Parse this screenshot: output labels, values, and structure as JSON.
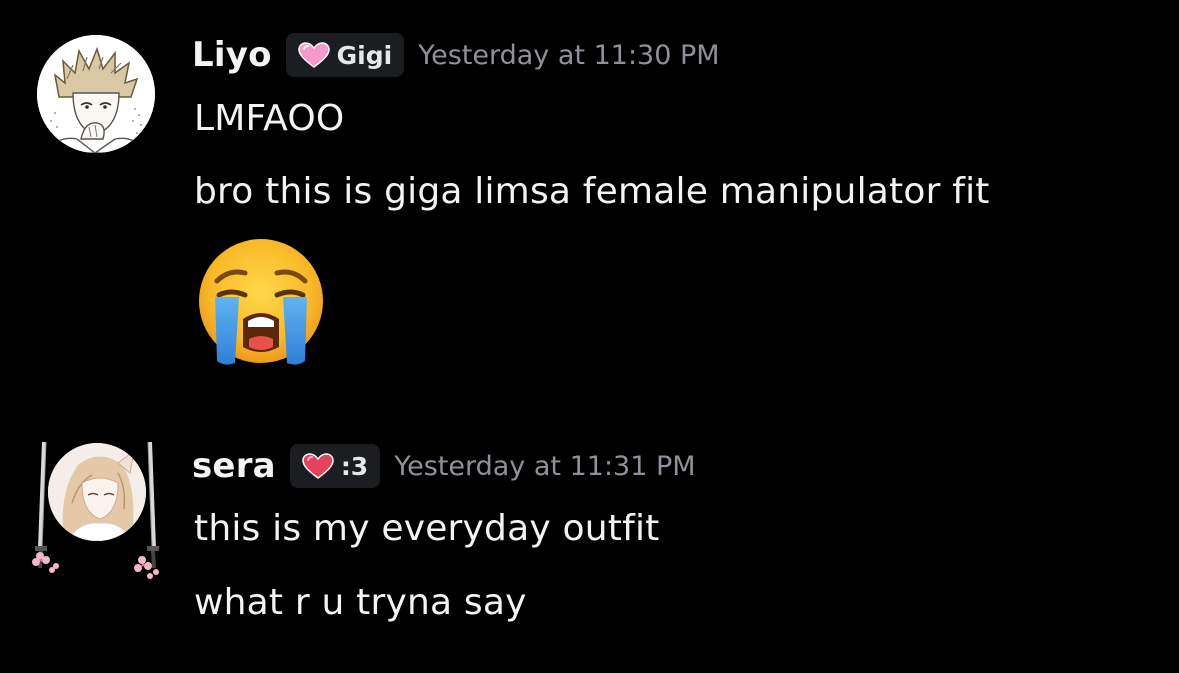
{
  "messages": [
    {
      "username": "Liyo",
      "tag": "Gigi",
      "tag_icon": "pink-heart-icon",
      "timestamp": "Yesterday at 11:30 PM",
      "lines": [
        "LMFAOO",
        "bro this is giga limsa female manipulator fit"
      ],
      "emoji": "loudly-crying-face-emoji"
    },
    {
      "username": "sera",
      "tag": ":3",
      "tag_icon": "red-heart-icon",
      "timestamp": "Yesterday at 11:31 PM",
      "lines": [
        "this is my everyday outfit",
        "what r u tryna say"
      ]
    }
  ],
  "colors": {
    "background": "#000000",
    "text": "#f2f3f5",
    "timestamp": "#8e9199",
    "tag_background": "#1c1d21"
  }
}
